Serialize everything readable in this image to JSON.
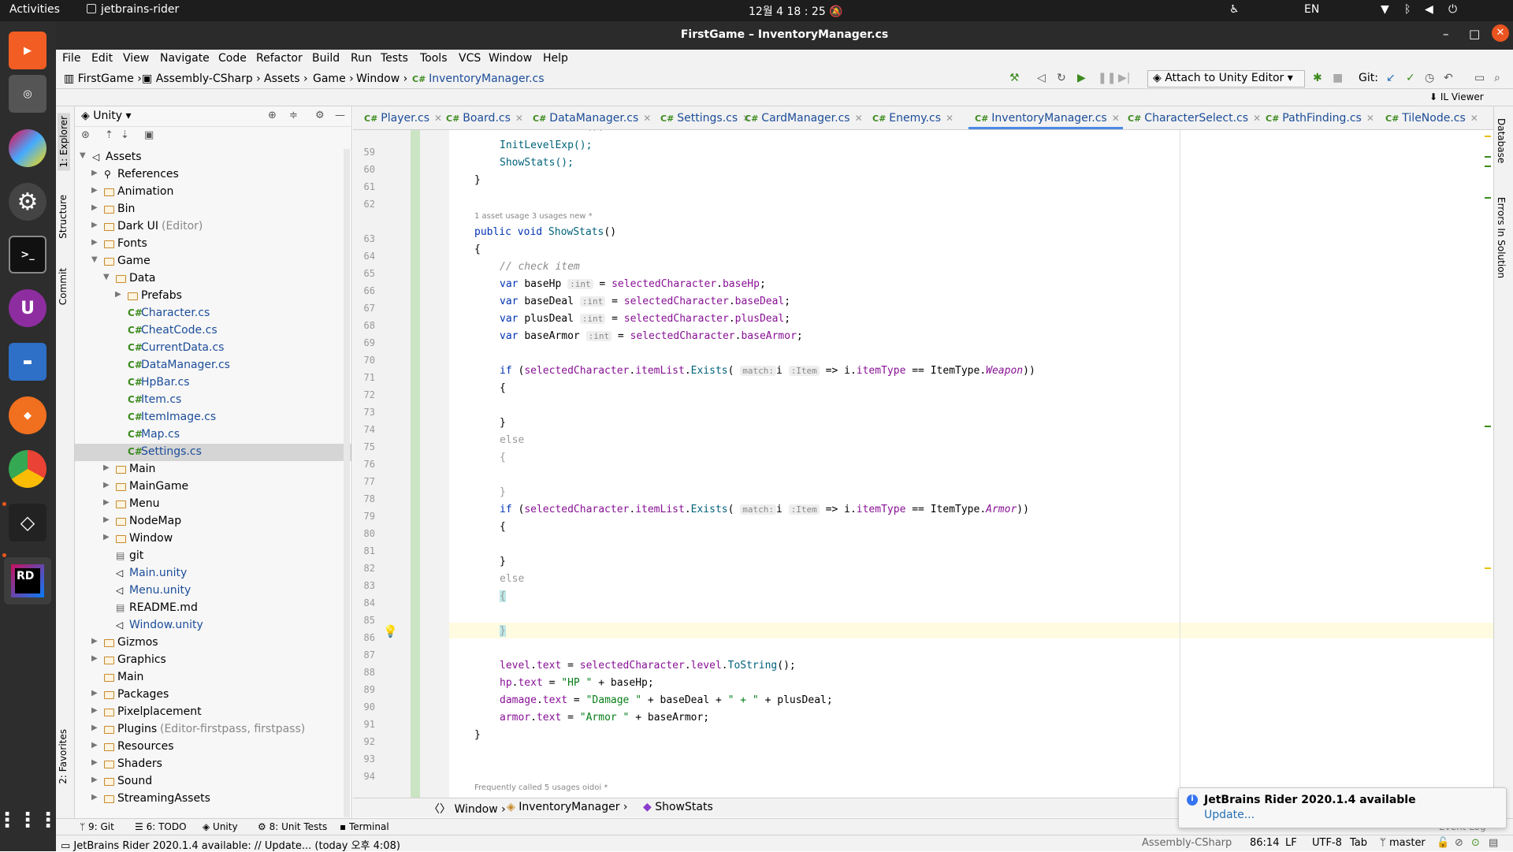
{
  "topbar": {
    "activities": "Activities",
    "app": "jetbrains-rider",
    "clock": "12월 4  18 : 25",
    "lang": "EN"
  },
  "window": {
    "title": "FirstGame – InventoryManager.cs"
  },
  "menu": [
    "File",
    "Edit",
    "View",
    "Navigate",
    "Code",
    "Refactor",
    "Build",
    "Run",
    "Tests",
    "Tools",
    "VCS",
    "Window",
    "Help"
  ],
  "breadcrumb": [
    "FirstGame",
    "Assembly-CSharp",
    "Assets",
    "Game",
    "Window",
    "InventoryManager.cs"
  ],
  "run_config": "Attach to Unity Editor",
  "git_label": "Git:",
  "il_viewer": "IL Viewer",
  "side_tabs": {
    "explorer": "1: Explorer",
    "structure": "Structure",
    "commit": "Commit",
    "favorites": "2: Favorites",
    "database": "Database",
    "errors": "Errors In Solution"
  },
  "explorer": {
    "title": "Unity",
    "tree": [
      {
        "label": "Assets",
        "type": "unity-root",
        "depth": 0,
        "open": true
      },
      {
        "label": "References",
        "type": "ref",
        "depth": 1
      },
      {
        "label": "Animation",
        "type": "folder",
        "depth": 1
      },
      {
        "label": "Bin",
        "type": "folder",
        "depth": 1
      },
      {
        "label": "Dark UI",
        "extra": "(Editor)",
        "type": "folder",
        "depth": 1
      },
      {
        "label": "Fonts",
        "type": "folder",
        "depth": 1
      },
      {
        "label": "Game",
        "type": "folder",
        "depth": 1,
        "open": true
      },
      {
        "label": "Data",
        "type": "folder",
        "depth": 2,
        "open": true
      },
      {
        "label": "Prefabs",
        "type": "folder",
        "depth": 3
      },
      {
        "label": "Character.cs",
        "type": "cs",
        "depth": 3
      },
      {
        "label": "CheatCode.cs",
        "type": "cs",
        "depth": 3
      },
      {
        "label": "CurrentData.cs",
        "type": "cs",
        "depth": 3
      },
      {
        "label": "DataManager.cs",
        "type": "cs",
        "depth": 3
      },
      {
        "label": "HpBar.cs",
        "type": "cs",
        "depth": 3
      },
      {
        "label": "Item.cs",
        "type": "cs",
        "depth": 3
      },
      {
        "label": "ItemImage.cs",
        "type": "cs",
        "depth": 3
      },
      {
        "label": "Map.cs",
        "type": "cs",
        "depth": 3
      },
      {
        "label": "Settings.cs",
        "type": "cs",
        "depth": 3,
        "selected": true
      },
      {
        "label": "Main",
        "type": "folder",
        "depth": 2
      },
      {
        "label": "MainGame",
        "type": "folder",
        "depth": 2
      },
      {
        "label": "Menu",
        "type": "folder",
        "depth": 2
      },
      {
        "label": "NodeMap",
        "type": "folder",
        "depth": 2
      },
      {
        "label": "Window",
        "type": "folder",
        "depth": 2
      },
      {
        "label": "git",
        "type": "file",
        "depth": 2
      },
      {
        "label": "Main.unity",
        "type": "unity",
        "depth": 2
      },
      {
        "label": "Menu.unity",
        "type": "unity",
        "depth": 2
      },
      {
        "label": "README.md",
        "type": "file",
        "depth": 2
      },
      {
        "label": "Window.unity",
        "type": "unity",
        "depth": 2
      },
      {
        "label": "Gizmos",
        "type": "folder",
        "depth": 1
      },
      {
        "label": "Graphics",
        "type": "folder",
        "depth": 1
      },
      {
        "label": "Main",
        "type": "folder",
        "depth": 1,
        "noarrow": true
      },
      {
        "label": "Packages",
        "type": "folder",
        "depth": 1
      },
      {
        "label": "Pixelplacement",
        "type": "folder",
        "depth": 1
      },
      {
        "label": "Plugins",
        "extra": "(Editor-firstpass, firstpass)",
        "type": "folder",
        "depth": 1
      },
      {
        "label": "Resources",
        "type": "folder",
        "depth": 1
      },
      {
        "label": "Shaders",
        "type": "folder",
        "depth": 1
      },
      {
        "label": "Sound",
        "type": "folder",
        "depth": 1
      },
      {
        "label": "StreamingAssets",
        "type": "folder",
        "depth": 1
      }
    ]
  },
  "tabs": [
    {
      "label": "Player.cs"
    },
    {
      "label": "Board.cs"
    },
    {
      "label": "DataManager.cs"
    },
    {
      "label": "Settings.cs"
    },
    {
      "label": "CardManager.cs"
    },
    {
      "label": "Enemy.cs"
    },
    {
      "label": "InventoryManager.cs",
      "active": true
    },
    {
      "label": "CharacterSelect.cs"
    },
    {
      "label": "PathFinding.cs"
    },
    {
      "label": "TileNode.cs"
    }
  ],
  "line_numbers": [
    "59",
    "60",
    "61",
    "62",
    "63",
    "64",
    "65",
    "66",
    "67",
    "68",
    "69",
    "70",
    "71",
    "72",
    "73",
    "74",
    "75",
    "76",
    "77",
    "78",
    "79",
    "80",
    "81",
    "82",
    "83",
    "84",
    "85",
    "86",
    "87",
    "88",
    "89",
    "90",
    "91",
    "92",
    "93",
    "94"
  ],
  "code": {
    "l59": "InitLevelExp();",
    "l60": "ShowStats();",
    "l61": "}",
    "lens1": "1 asset usage   3 usages   new *",
    "l63_kw": "public void ",
    "l63_fn": "ShowStats",
    "l63_end": "()",
    "l64": "{",
    "l65": "// check item",
    "var": "var ",
    "eq": " = ",
    "sel": "selectedCharacter",
    "hint_int": ":int",
    "v1": "baseHp",
    "p1": "baseHp",
    "v2": "baseDeal",
    "p2": "baseDeal",
    "v3": "plusDeal",
    "p3": "plusDeal",
    "v4": "baseArmor",
    "p4": "baseArmor",
    "if": "if",
    "itemList": "itemList",
    "exists": "Exists",
    "hint_match": "match:",
    "i": "i",
    "hint_item": ":Item",
    "lambda": " => i.",
    "itemType": "itemType",
    "eqeq": " == ItemType.",
    "weapon": "Weapon",
    "armor": "Armor",
    "else": "else",
    "open": "{",
    "close": "}",
    "level": "level",
    "text": "text",
    "toString": "ToString",
    "hp": "hp",
    "damage": "damage",
    "armorf": "armor",
    "s_hp": "\"HP \"",
    "s_damage": "\"Damage \"",
    "s_plus": "\" + \"",
    "s_armor": "\"Armor \"",
    "lens2": "Frequently called   5 usages   oidoi *"
  },
  "code_nav": [
    "Window",
    "InventoryManager",
    "ShowStats"
  ],
  "tool_windows": [
    "9: Git",
    "6: TODO",
    "Unity",
    "8: Unit Tests",
    "Terminal"
  ],
  "status": {
    "message": "JetBrains Rider 2020.1.4 available: // Update... (today 오후 4:08)",
    "project": "Assembly-CSharp",
    "position": "86:14",
    "line_sep": "LF",
    "encoding": "UTF-8",
    "indent": "Tab",
    "branch": "master"
  },
  "notification": {
    "title": "JetBrains Rider 2020.1.4 available",
    "link": "Update..."
  },
  "event_log": "Event Log"
}
